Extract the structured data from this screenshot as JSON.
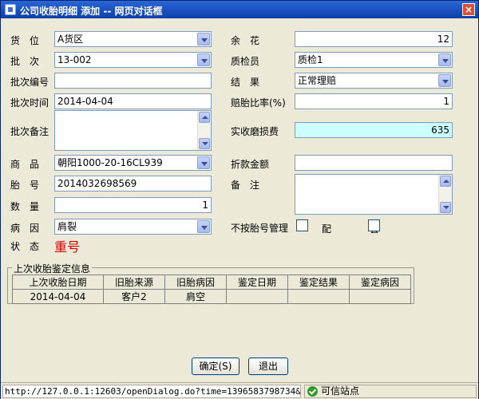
{
  "window": {
    "title": "公司收胎明细 添加 -- 网页对话框",
    "close_symbol": "×"
  },
  "left": {
    "location_label": "货　位",
    "location_value": "A货区",
    "batch_label": "批　次",
    "batch_value": "13-002",
    "batch_no_label": "批次编号",
    "batch_no_value": "",
    "batch_time_label": "批次时间",
    "batch_time_value": "2014-04-04",
    "batch_note_label": "批次备注",
    "product_label": "商　品",
    "product_value": "朝阳1000-20-16CL939",
    "tire_no_label": "胎　号",
    "tire_no_value": "2014032698569",
    "qty_label": "数　量",
    "qty_value": "1",
    "cause_label": "病　因",
    "cause_value": "肩裂",
    "status_label": "状　态",
    "status_value": "重号"
  },
  "right": {
    "remain_label": "余　花",
    "remain_value": "12",
    "inspector_label": "质检员",
    "inspector_value": "质检1",
    "result_label": "结　果",
    "result_value": "正常理赔",
    "ratio_label": "赔胎比率(%)",
    "ratio_value": "1",
    "wear_fee_label": "实收磨损费",
    "wear_fee_value": "635",
    "discount_label": "折款金额",
    "discount_value": "",
    "remark_label": "备　注",
    "no_tire_mgmt_label": "不按胎号管理",
    "pair_label": "配　套"
  },
  "history": {
    "legend": "上次收胎鉴定信息",
    "headers": [
      "上次收胎日期",
      "旧胎来源",
      "旧胎病因",
      "鉴定日期",
      "鉴定结果",
      "鉴定病因"
    ],
    "row": [
      "2014-04-04",
      "客户2",
      "肩空",
      "",
      "",
      ""
    ]
  },
  "buttons": {
    "ok": "确定(S)",
    "exit": "退出"
  },
  "statusbar": {
    "url": "http://127.0.0.1:12603/openDialog.do?time=1396583798734&openDi",
    "zone": "可信站点",
    "zone_icon": "check-icon"
  }
}
